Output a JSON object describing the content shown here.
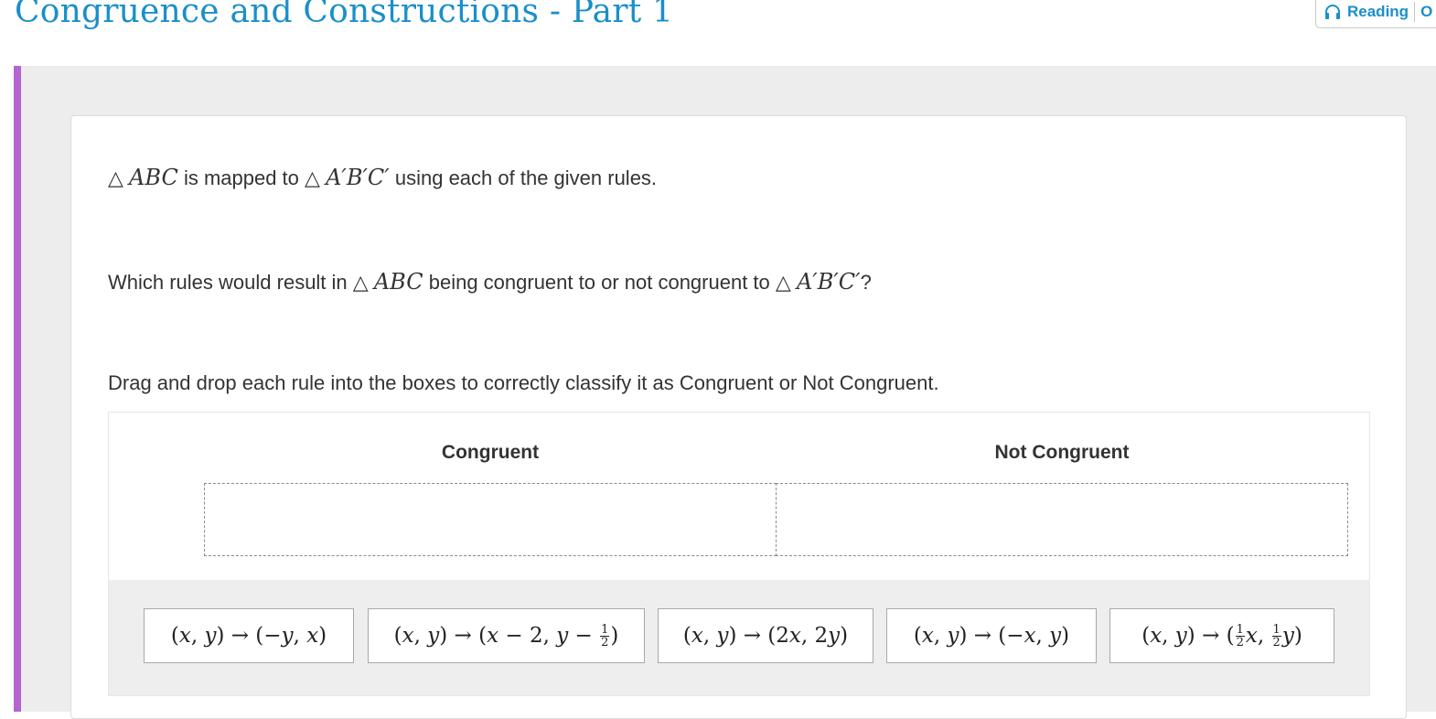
{
  "header": {
    "title": "Congruence and Constructions - Part 1",
    "reading_label": "Reading",
    "reading_extra": "O",
    "reading_icon": "headphones-icon"
  },
  "question": {
    "line1_pre": "ABC",
    "line1_mid": " is mapped to ",
    "line1_tri2": "A′B′C′",
    "line1_post": " using each of the given rules.",
    "line2_pre": "Which rules would result in ",
    "line2_tri1": "ABC",
    "line2_mid": " being congruent to or not congruent to ",
    "line2_tri2": "A′B′C′",
    "line2_post": "?",
    "instruction": "Drag and drop each rule into the boxes to correctly classify it as Congruent or Not Congruent.",
    "triangle_symbol": "△"
  },
  "categories": [
    {
      "label": "Congruent",
      "items": []
    },
    {
      "label": "Not Congruent",
      "items": []
    }
  ],
  "rules": [
    "(x, y) → (−y, x)",
    "(x, y) → (x − 2, y − 1/2)",
    "(x, y) → (2x, 2y)",
    "(x, y) → (−x, y)",
    "(x, y) → (1/2 x, 1/2 y)"
  ],
  "colors": {
    "title": "#1a8fc9",
    "accent": "#b565d0",
    "workspace": "#ededed"
  }
}
